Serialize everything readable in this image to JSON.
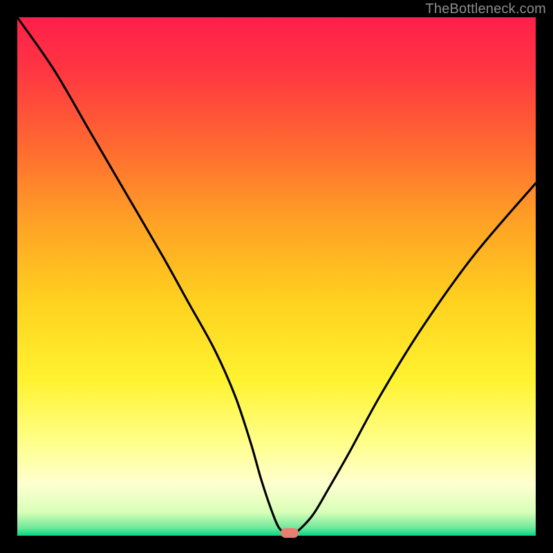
{
  "watermark": {
    "text": "TheBottleneck.com"
  },
  "chart_data": {
    "type": "line",
    "title": "",
    "xlabel": "",
    "ylabel": "",
    "xlim": [
      0,
      100
    ],
    "ylim": [
      0,
      100
    ],
    "grid": false,
    "legend": false,
    "gradient_stops": [
      {
        "offset": 0.0,
        "color": "#ff1f4b"
      },
      {
        "offset": 0.1,
        "color": "#ff3542"
      },
      {
        "offset": 0.25,
        "color": "#ff6a30"
      },
      {
        "offset": 0.4,
        "color": "#ffa325"
      },
      {
        "offset": 0.55,
        "color": "#ffd21f"
      },
      {
        "offset": 0.7,
        "color": "#fff330"
      },
      {
        "offset": 0.82,
        "color": "#ffff8a"
      },
      {
        "offset": 0.9,
        "color": "#ffffd0"
      },
      {
        "offset": 0.955,
        "color": "#d8ffb8"
      },
      {
        "offset": 0.985,
        "color": "#6fe89a"
      },
      {
        "offset": 1.0,
        "color": "#00d982"
      }
    ],
    "series": [
      {
        "name": "bottleneck-curve",
        "x": [
          0,
          7,
          14,
          21,
          28,
          33,
          38,
          42,
          45,
          47,
          49,
          50.5,
          52,
          53,
          54,
          57,
          60,
          64,
          70,
          78,
          88,
          100
        ],
        "y": [
          100,
          90,
          78,
          66,
          54,
          45,
          36,
          27,
          18,
          11,
          5,
          1.5,
          0.5,
          0.5,
          0.8,
          4,
          9,
          16,
          27,
          40,
          54,
          68
        ]
      }
    ],
    "marker": {
      "x": 52.5,
      "y": 0.5,
      "color": "#e77f72"
    }
  }
}
